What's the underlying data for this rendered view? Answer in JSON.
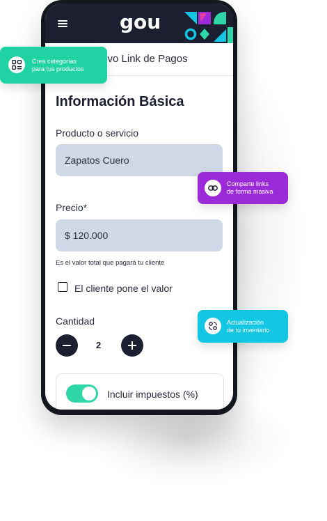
{
  "app": {
    "logo": "gou",
    "subheader_title": "Nuevo Link de Pagos"
  },
  "form": {
    "section_title": "Información Básica",
    "product_label": "Producto o servicio",
    "product_value": "Zapatos Cuero",
    "price_label": "Precio*",
    "price_value": "$ 120.000",
    "price_helper": "Es el valor total que pagará tu cliente",
    "client_value_checkbox_label": "El cliente pone el valor",
    "client_value_checked": false,
    "quantity_label": "Cantidad",
    "quantity_value": "2",
    "tax_toggle_label": "Incluir impuestos (%)",
    "tax_toggle_on": true
  },
  "badges": [
    {
      "text_line1": "Crea categorías",
      "text_line2": "para tus productos",
      "color": "#21d3a4",
      "icon": "grid-icon"
    },
    {
      "text_line1": "Comparte links",
      "text_line2": "de forma masiva",
      "color": "#9b2bd9",
      "icon": "link-icon"
    },
    {
      "text_line1": "Actualización",
      "text_line2": "de tu inventario",
      "color": "#13c6e4",
      "icon": "inventory-icon"
    }
  ],
  "colors": {
    "navy": "#1c1f30",
    "field": "#cfd8e6",
    "toggle": "#2ed6a8"
  }
}
